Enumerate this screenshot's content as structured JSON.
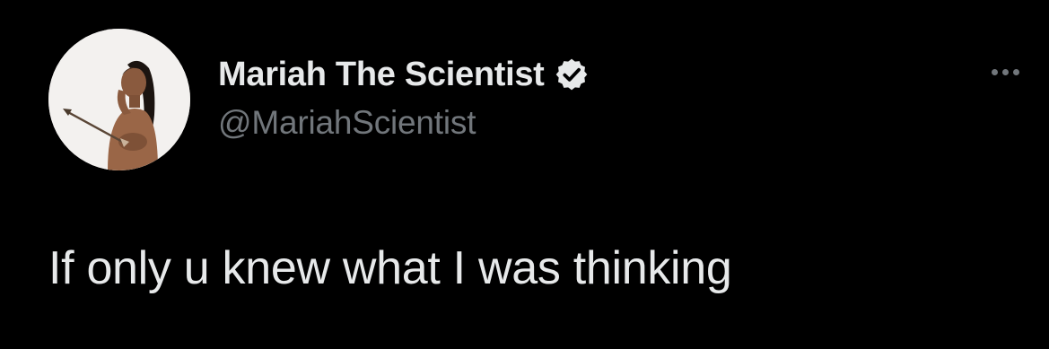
{
  "tweet": {
    "author": {
      "display_name": "Mariah The Scientist",
      "handle": "@MariahScientist",
      "verified": true,
      "verified_icon": "verified-badge-icon",
      "avatar": "profile-photo"
    },
    "more_icon": "more-options-icon",
    "text": "If only u knew what I was thinking"
  },
  "colors": {
    "background": "#000000",
    "primary_text": "#e7e9ea",
    "secondary_text": "#71767b",
    "verified_badge": "#e7e9ea"
  }
}
